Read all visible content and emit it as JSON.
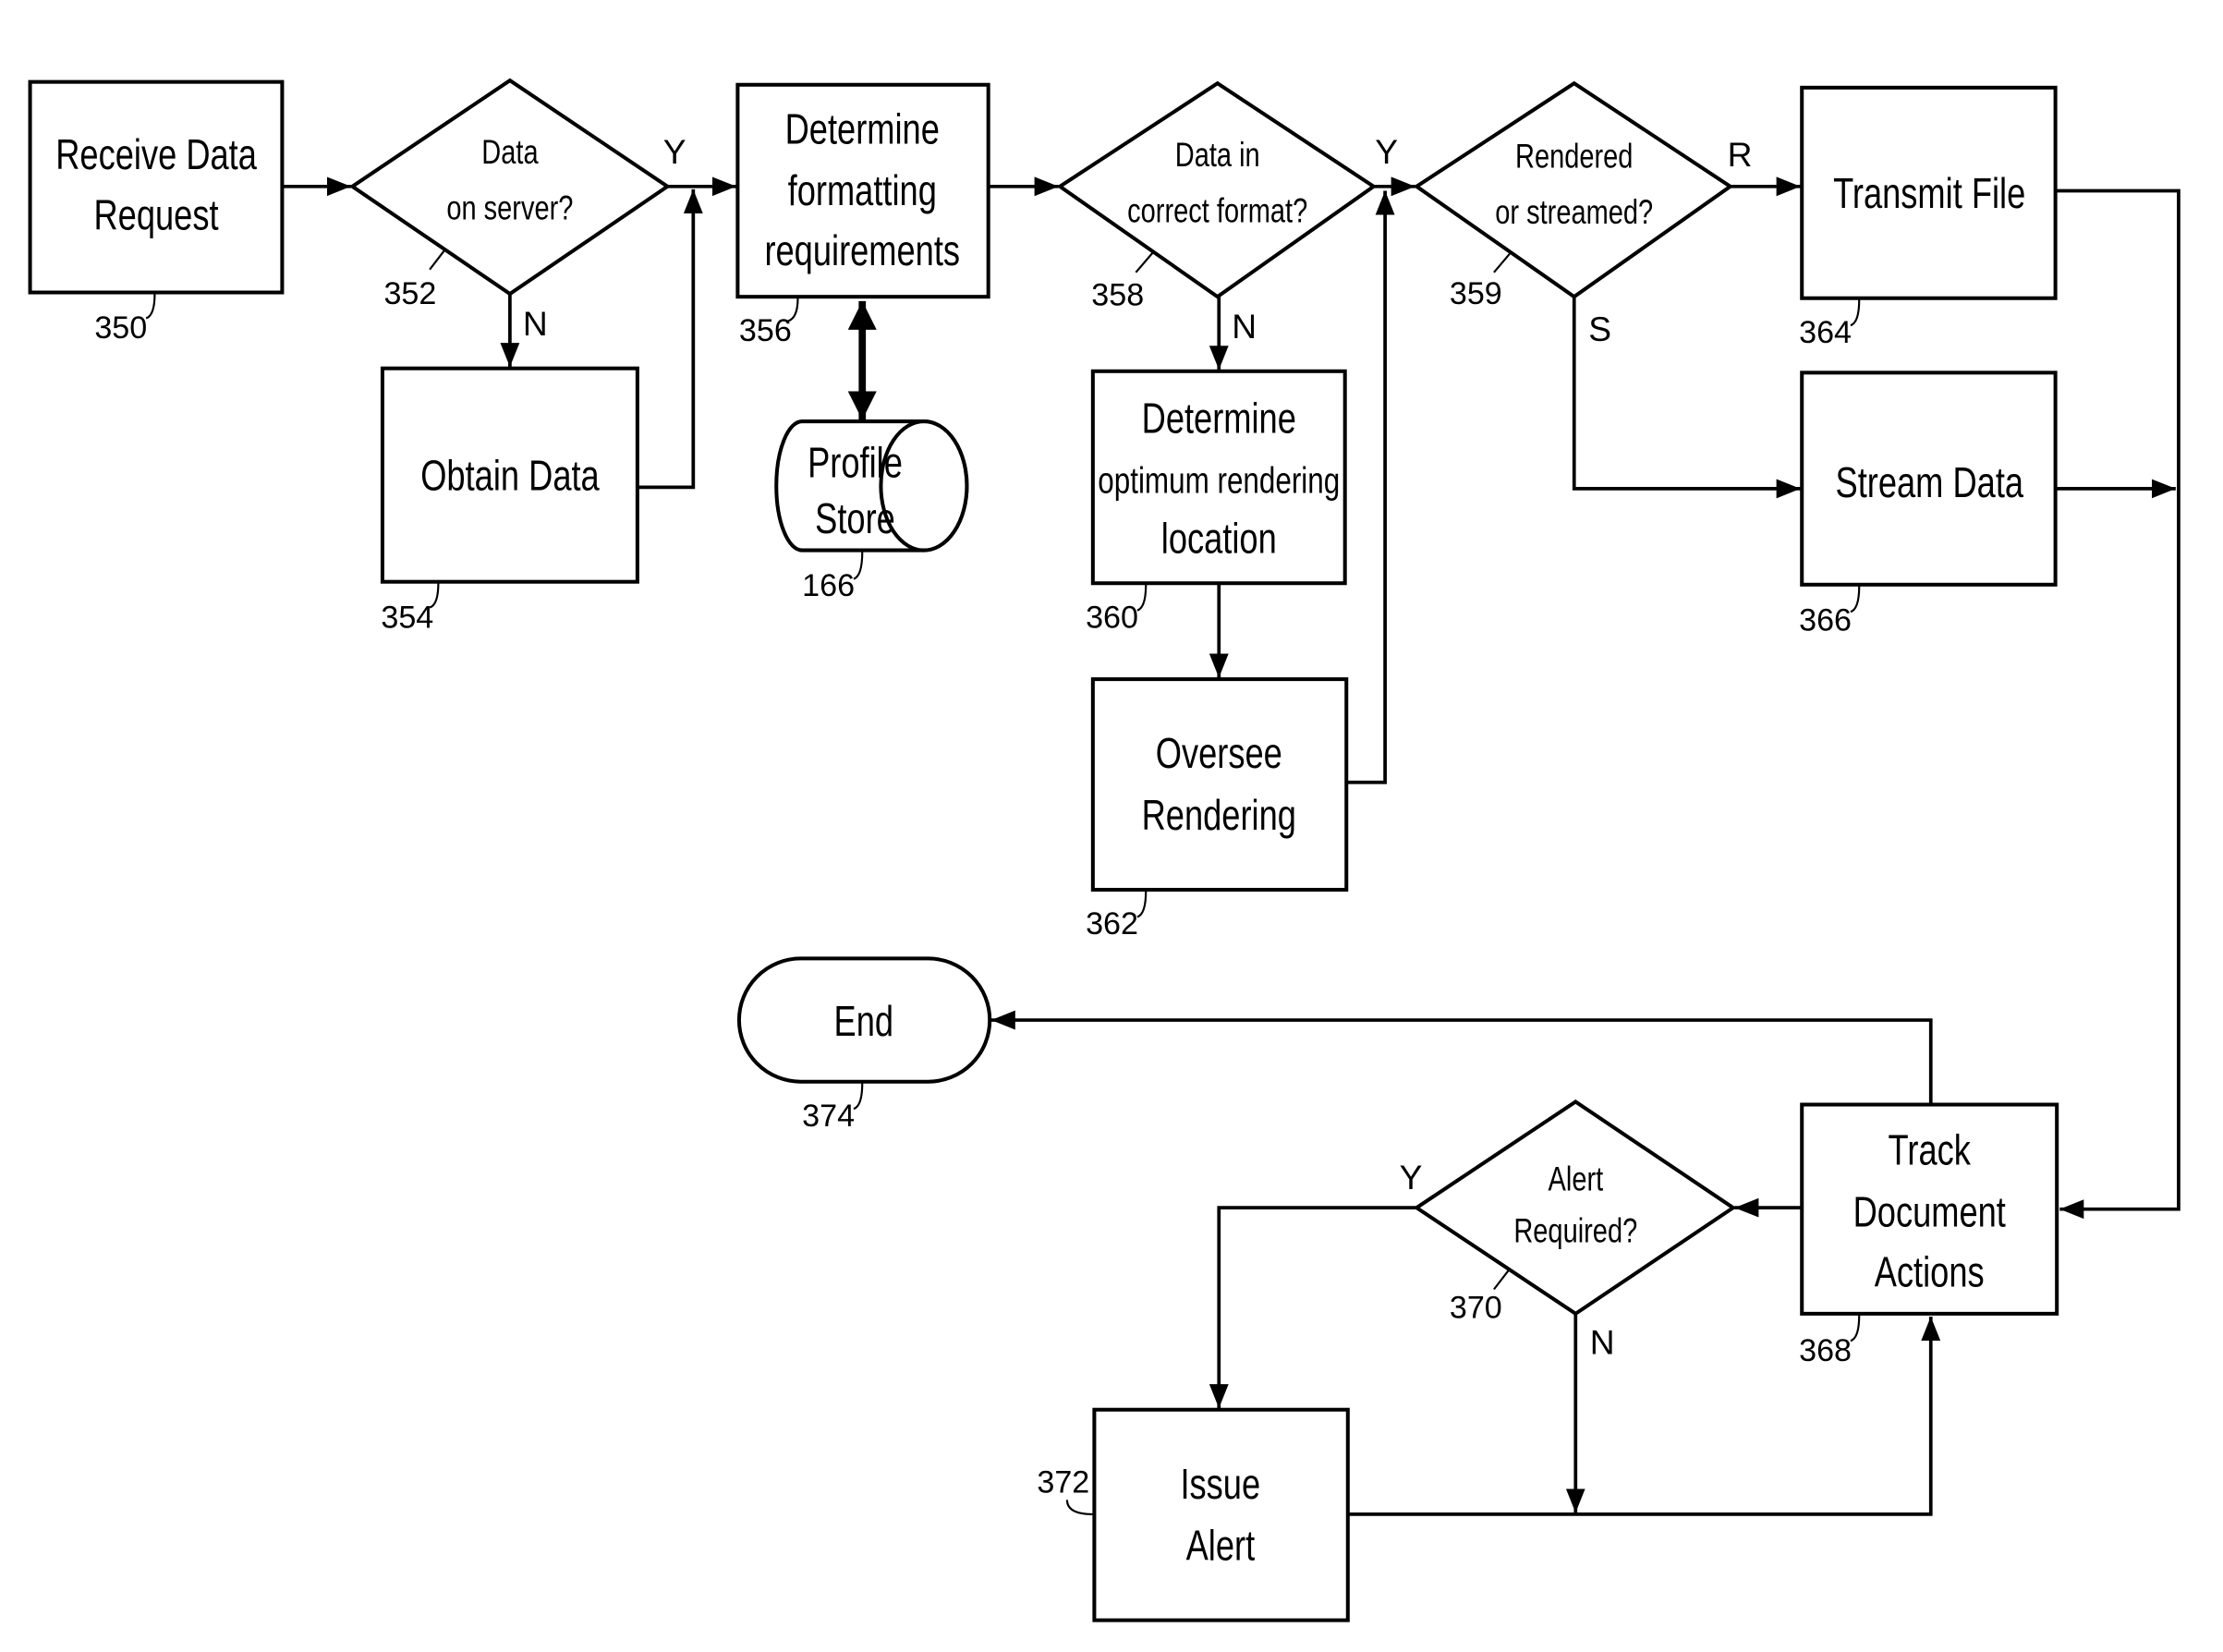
{
  "diagram": {
    "type": "flowchart",
    "nodes": {
      "n350": {
        "ref": "350",
        "kind": "process",
        "lines": [
          "Receive Data",
          "Request"
        ]
      },
      "n352": {
        "ref": "352",
        "kind": "decision",
        "lines": [
          "Data",
          "on server?"
        ]
      },
      "n354": {
        "ref": "354",
        "kind": "process",
        "lines": [
          "Obtain Data"
        ]
      },
      "n356": {
        "ref": "356",
        "kind": "process",
        "lines": [
          "Determine",
          "formatting",
          "requirements"
        ]
      },
      "n166": {
        "ref": "166",
        "kind": "datastore",
        "lines": [
          "Profile",
          "Store"
        ]
      },
      "n358": {
        "ref": "358",
        "kind": "decision",
        "lines": [
          "Data in",
          "correct format?"
        ]
      },
      "n360": {
        "ref": "360",
        "kind": "process",
        "lines": [
          "Determine",
          "optimum rendering",
          "location"
        ]
      },
      "n362": {
        "ref": "362",
        "kind": "process",
        "lines": [
          "Oversee",
          "Rendering"
        ]
      },
      "n359": {
        "ref": "359",
        "kind": "decision",
        "lines": [
          "Rendered",
          "or streamed?"
        ]
      },
      "n364": {
        "ref": "364",
        "kind": "process",
        "lines": [
          "Transmit File"
        ]
      },
      "n366": {
        "ref": "366",
        "kind": "process",
        "lines": [
          "Stream Data"
        ]
      },
      "n368": {
        "ref": "368",
        "kind": "process",
        "lines": [
          "Track",
          "Document",
          "Actions"
        ]
      },
      "n370": {
        "ref": "370",
        "kind": "decision",
        "lines": [
          "Alert",
          "Required?"
        ]
      },
      "n372": {
        "ref": "372",
        "kind": "process",
        "lines": [
          "Issue",
          "Alert"
        ]
      },
      "n374": {
        "ref": "374",
        "kind": "terminator",
        "lines": [
          "End"
        ]
      }
    },
    "edge_labels": {
      "e352_yes": "Y",
      "e352_no": "N",
      "e358_yes": "Y",
      "e358_no": "N",
      "e359_r": "R",
      "e359_s": "S",
      "e370_yes": "Y",
      "e370_no": "N"
    },
    "edges": [
      {
        "from": "350",
        "to": "352"
      },
      {
        "from": "352",
        "to": "356",
        "label": "Y"
      },
      {
        "from": "352",
        "to": "354",
        "label": "N"
      },
      {
        "from": "354",
        "to": "356"
      },
      {
        "from": "356",
        "to": "166",
        "bidirectional": true
      },
      {
        "from": "356",
        "to": "358"
      },
      {
        "from": "358",
        "to": "359",
        "label": "Y"
      },
      {
        "from": "358",
        "to": "360",
        "label": "N"
      },
      {
        "from": "360",
        "to": "362"
      },
      {
        "from": "362",
        "to": "359"
      },
      {
        "from": "359",
        "to": "364",
        "label": "R"
      },
      {
        "from": "359",
        "to": "366",
        "label": "S"
      },
      {
        "from": "364",
        "to": "368"
      },
      {
        "from": "366",
        "to": "368"
      },
      {
        "from": "368",
        "to": "370"
      },
      {
        "from": "368",
        "to": "374"
      },
      {
        "from": "370",
        "to": "372",
        "label": "Y"
      },
      {
        "from": "370",
        "to": "368",
        "label": "N"
      },
      {
        "from": "372",
        "to": "368"
      }
    ]
  }
}
